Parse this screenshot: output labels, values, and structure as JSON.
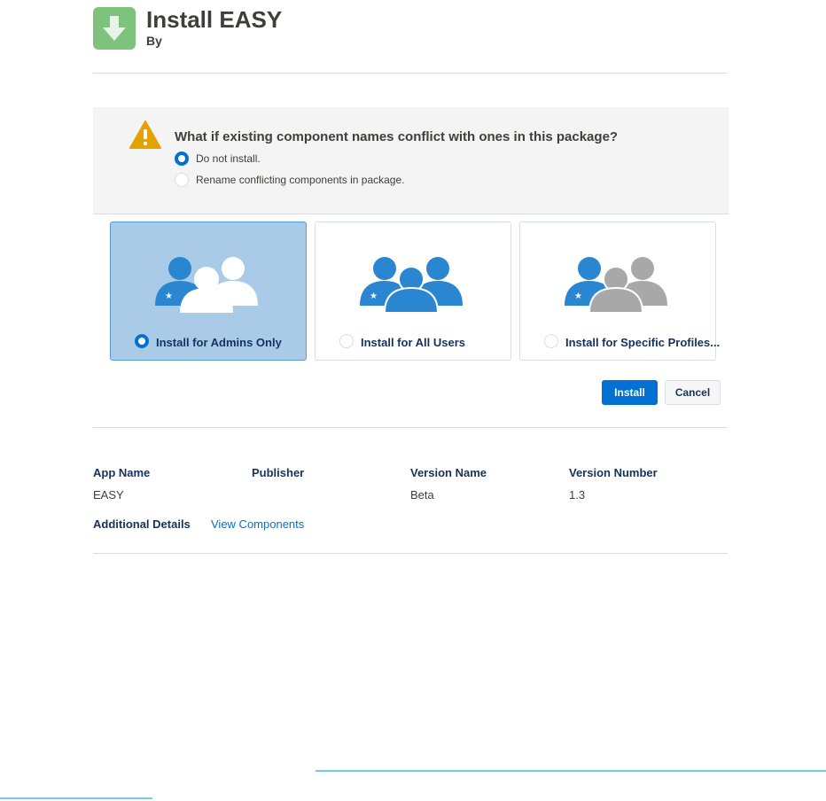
{
  "header": {
    "title": "Install EASY",
    "byline": "By",
    "icon": "download-arrow-icon"
  },
  "conflict": {
    "question": "What if existing component names conflict with ones in this package?",
    "options": [
      {
        "label": "Do not install.",
        "selected": true
      },
      {
        "label": "Rename conflicting components in package.",
        "selected": false
      }
    ]
  },
  "install_options": [
    {
      "label": "Install for Admins Only",
      "selected": true
    },
    {
      "label": "Install for All Users",
      "selected": false
    },
    {
      "label": "Install for Specific Profiles...",
      "selected": false
    }
  ],
  "actions": {
    "install": "Install",
    "cancel": "Cancel"
  },
  "details": {
    "headers": [
      "App Name",
      "Publisher",
      "Version Name",
      "Version Number"
    ],
    "values": [
      "EASY",
      "",
      "Beta",
      "1.3"
    ],
    "additional_label": "Additional Details",
    "view_components": "View Components"
  },
  "colors": {
    "primary": "#0070d2",
    "app_icon": "#7dc37d",
    "warning": "#e4a201",
    "person_blue": "#2a86d1",
    "person_gray": "#a8a8a8"
  }
}
